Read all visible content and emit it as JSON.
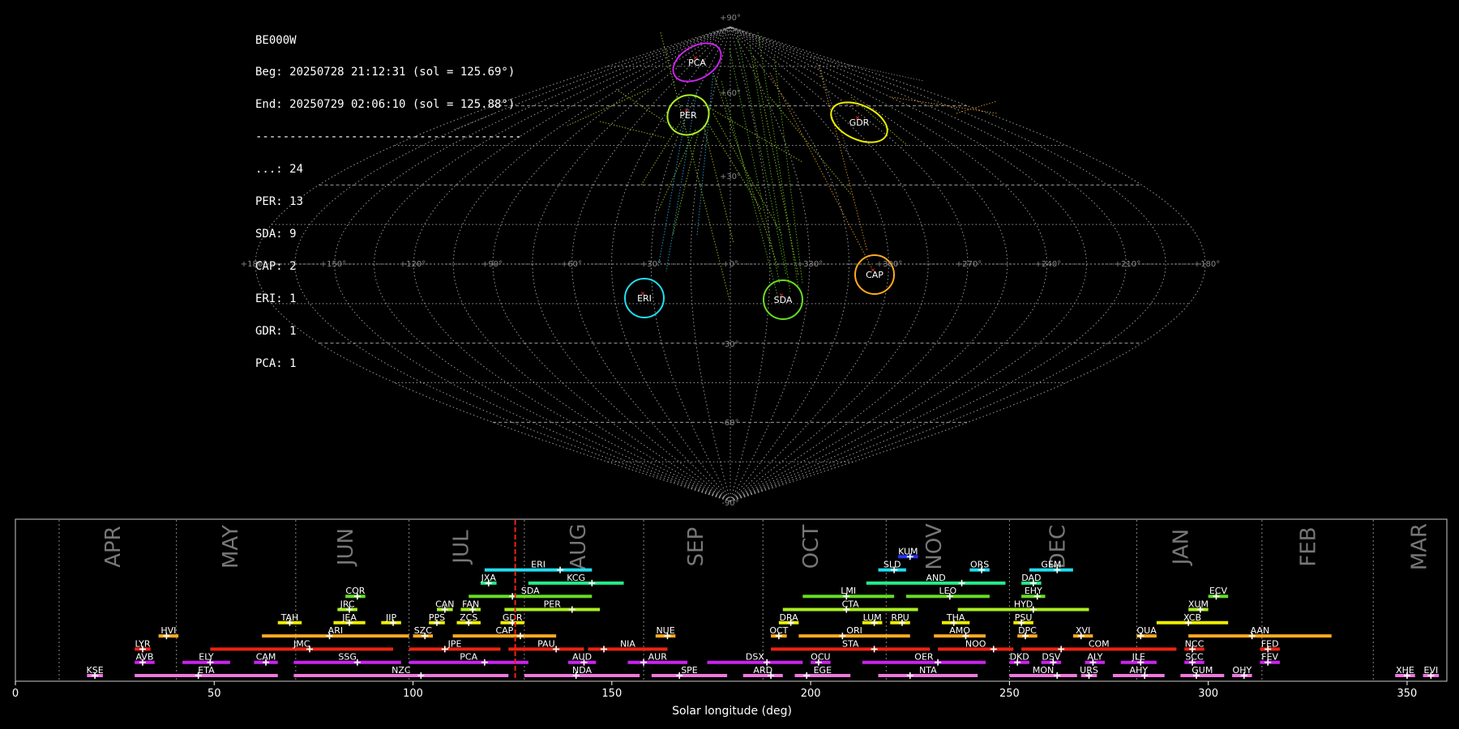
{
  "info": {
    "station": "BE000W",
    "begin": "Beg: 20250728 21:12:31 (sol = 125.69°)",
    "end": "End: 20250729 02:06:10 (sol = 125.88°)",
    "separator": "---------------------------------------",
    "counts": [
      "...: 24",
      "PER: 13",
      "SDA: 9",
      "CAP: 2",
      "ERI: 1",
      "GDR: 1",
      "PCA: 1"
    ]
  },
  "sky_map": {
    "lon_ticks": [
      "+180°",
      "+150°",
      "+120°",
      "+90°",
      "+60°",
      "+30°",
      "+0°",
      "+330°",
      "+300°",
      "+270°",
      "+240°",
      "+210°",
      "+180°"
    ],
    "lat_ticks": [
      "+90°",
      "+60°",
      "+30°",
      "-30°",
      "-60°",
      "-90°"
    ],
    "radiants": [
      {
        "code": "PCA",
        "color": "#cc22ee"
      },
      {
        "code": "PER",
        "color": "#aaee22"
      },
      {
        "code": "GDR",
        "color": "#eeee00"
      },
      {
        "code": "CAP",
        "color": "#ffaa22"
      },
      {
        "code": "ERI",
        "color": "#22ddee"
      },
      {
        "code": "SDA",
        "color": "#66dd22"
      }
    ]
  },
  "chart_data": {
    "type": "timeline",
    "xlabel": "Solar longitude (deg)",
    "xlim": [
      0,
      360
    ],
    "xticks": [
      0,
      50,
      100,
      150,
      200,
      250,
      300,
      350
    ],
    "current_sol": 125.7,
    "months": [
      {
        "name": "APR",
        "x": 24.5
      },
      {
        "name": "MAY",
        "x": 54
      },
      {
        "name": "JUN",
        "x": 83
      },
      {
        "name": "JUL",
        "x": 112
      },
      {
        "name": "AUG",
        "x": 141.5
      },
      {
        "name": "SEP",
        "x": 171
      },
      {
        "name": "OCT",
        "x": 200
      },
      {
        "name": "NOV",
        "x": 231
      },
      {
        "name": "DEC",
        "x": 262
      },
      {
        "name": "JAN",
        "x": 293
      },
      {
        "name": "FEB",
        "x": 325
      },
      {
        "name": "MAR",
        "x": 353
      }
    ],
    "month_dividers": [
      11,
      40.5,
      70.5,
      99,
      128,
      158,
      188,
      219,
      250,
      282,
      313.5,
      341.5
    ],
    "showers": [
      {
        "code": "KUM",
        "start": 222,
        "end": 227,
        "peak": 225,
        "row": 10,
        "color": "#2233ff"
      },
      {
        "code": "ERI",
        "start": 118,
        "end": 145,
        "peak": 137,
        "row": 9,
        "color": "#22ddee"
      },
      {
        "code": "SLD",
        "start": 217,
        "end": 224,
        "peak": 221,
        "row": 9,
        "color": "#22ddee"
      },
      {
        "code": "ORS",
        "start": 240,
        "end": 245,
        "peak": 243,
        "row": 9,
        "color": "#22ddee"
      },
      {
        "code": "GEM",
        "start": 255,
        "end": 266,
        "peak": 262,
        "row": 9,
        "color": "#22ddee"
      },
      {
        "code": "JXA",
        "start": 117,
        "end": 121,
        "peak": 119,
        "row": 8,
        "color": "#22ee88"
      },
      {
        "code": "KCG",
        "start": 129,
        "end": 153,
        "peak": 145,
        "row": 8,
        "color": "#22ee88"
      },
      {
        "code": "AND",
        "start": 214,
        "end": 249,
        "peak": 238,
        "row": 8,
        "color": "#22ee88"
      },
      {
        "code": "DAD",
        "start": 253,
        "end": 258,
        "peak": 256,
        "row": 8,
        "color": "#22ee88"
      },
      {
        "code": "COR",
        "start": 83,
        "end": 88,
        "peak": 86,
        "row": 7,
        "color": "#66dd22"
      },
      {
        "code": "SDA",
        "start": 114,
        "end": 145,
        "peak": 125,
        "row": 7,
        "color": "#66dd22"
      },
      {
        "code": "LMI",
        "start": 198,
        "end": 221,
        "peak": 209,
        "row": 7,
        "color": "#66dd22"
      },
      {
        "code": "LEO",
        "start": 224,
        "end": 245,
        "peak": 235,
        "row": 7,
        "color": "#66dd22"
      },
      {
        "code": "EHY",
        "start": 253,
        "end": 259,
        "peak": 257,
        "row": 7,
        "color": "#66dd22"
      },
      {
        "code": "ECV",
        "start": 300,
        "end": 305,
        "peak": 302,
        "row": 7,
        "color": "#66dd22"
      },
      {
        "code": "JRC",
        "start": 81,
        "end": 86,
        "peak": 84,
        "row": 6,
        "color": "#aaee22"
      },
      {
        "code": "CAN",
        "start": 106,
        "end": 110,
        "peak": 108,
        "row": 6,
        "color": "#aaee22"
      },
      {
        "code": "FAN",
        "start": 112,
        "end": 117,
        "peak": 115,
        "row": 6,
        "color": "#aaee22"
      },
      {
        "code": "PER",
        "start": 123,
        "end": 147,
        "peak": 140,
        "row": 6,
        "color": "#aaee22"
      },
      {
        "code": "CTA",
        "start": 193,
        "end": 227,
        "peak": 209,
        "row": 6,
        "color": "#aaee22"
      },
      {
        "code": "HYD",
        "start": 237,
        "end": 270,
        "peak": 256,
        "row": 6,
        "color": "#aaee22"
      },
      {
        "code": "XUM",
        "start": 295,
        "end": 300,
        "peak": 298,
        "row": 6,
        "color": "#aaee22"
      },
      {
        "code": "TAH",
        "start": 66,
        "end": 72,
        "peak": 69,
        "row": 5,
        "color": "#eeee00"
      },
      {
        "code": "JEA",
        "start": 80,
        "end": 88,
        "peak": 84,
        "row": 5,
        "color": "#eeee00"
      },
      {
        "code": "JIP",
        "start": 92,
        "end": 97,
        "peak": 95,
        "row": 5,
        "color": "#eeee00"
      },
      {
        "code": "PPS",
        "start": 104,
        "end": 108,
        "peak": 106,
        "row": 5,
        "color": "#eeee00"
      },
      {
        "code": "ZCS",
        "start": 111,
        "end": 117,
        "peak": 114,
        "row": 5,
        "color": "#eeee00"
      },
      {
        "code": "GDR",
        "start": 122,
        "end": 128,
        "peak": 125,
        "row": 5,
        "color": "#eeee00"
      },
      {
        "code": "DRA",
        "start": 192,
        "end": 197,
        "peak": 195,
        "row": 5,
        "color": "#eeee00"
      },
      {
        "code": "LUM",
        "start": 213,
        "end": 218,
        "peak": 216,
        "row": 5,
        "color": "#eeee00"
      },
      {
        "code": "RPU",
        "start": 220,
        "end": 225,
        "peak": 223,
        "row": 5,
        "color": "#eeee00"
      },
      {
        "code": "THA",
        "start": 233,
        "end": 240,
        "peak": 236,
        "row": 5,
        "color": "#eeee00"
      },
      {
        "code": "PSU",
        "start": 251,
        "end": 256,
        "peak": 253,
        "row": 5,
        "color": "#eeee00"
      },
      {
        "code": "XCB",
        "start": 287,
        "end": 305,
        "peak": 295,
        "row": 5,
        "color": "#eeee00"
      },
      {
        "code": "HVI",
        "start": 36,
        "end": 41,
        "peak": 38,
        "row": 4,
        "color": "#ffaa22"
      },
      {
        "code": "ARI",
        "start": 62,
        "end": 99,
        "peak": 79,
        "row": 4,
        "color": "#ffaa22"
      },
      {
        "code": "SZC",
        "start": 100,
        "end": 105,
        "peak": 103,
        "row": 4,
        "color": "#ffaa22"
      },
      {
        "code": "CAP",
        "start": 110,
        "end": 136,
        "peak": 127,
        "row": 4,
        "color": "#ffaa22"
      },
      {
        "code": "NUE",
        "start": 161,
        "end": 166,
        "peak": 164,
        "row": 4,
        "color": "#ffaa22"
      },
      {
        "code": "OCT",
        "start": 190,
        "end": 194,
        "peak": 192,
        "row": 4,
        "color": "#ffaa22"
      },
      {
        "code": "ORI",
        "start": 197,
        "end": 225,
        "peak": 208,
        "row": 4,
        "color": "#ffaa22"
      },
      {
        "code": "AMO",
        "start": 231,
        "end": 244,
        "peak": 239,
        "row": 4,
        "color": "#ffaa22"
      },
      {
        "code": "DPC",
        "start": 252,
        "end": 257,
        "peak": 254,
        "row": 4,
        "color": "#ffaa22"
      },
      {
        "code": "XVI",
        "start": 266,
        "end": 271,
        "peak": 268,
        "row": 4,
        "color": "#ffaa22"
      },
      {
        "code": "QUA",
        "start": 282,
        "end": 287,
        "peak": 283,
        "row": 4,
        "color": "#ffaa22"
      },
      {
        "code": "AAN",
        "start": 295,
        "end": 331,
        "peak": 311,
        "row": 4,
        "color": "#ffaa22"
      },
      {
        "code": "LYR",
        "start": 30,
        "end": 34,
        "peak": 32,
        "row": 3,
        "color": "#ee2211"
      },
      {
        "code": "JMC",
        "start": 49,
        "end": 95,
        "peak": 74,
        "row": 3,
        "color": "#ee2211"
      },
      {
        "code": "JPE",
        "start": 99,
        "end": 122,
        "peak": 108,
        "row": 3,
        "color": "#ee2211"
      },
      {
        "code": "PAU",
        "start": 124,
        "end": 143,
        "peak": 136,
        "row": 3,
        "color": "#ee2211"
      },
      {
        "code": "NIA",
        "start": 144,
        "end": 164,
        "peak": 148,
        "row": 3,
        "color": "#ee2211"
      },
      {
        "code": "STA",
        "start": 190,
        "end": 230,
        "peak": 216,
        "row": 3,
        "color": "#ee2211"
      },
      {
        "code": "NOO",
        "start": 232,
        "end": 251,
        "peak": 246,
        "row": 3,
        "color": "#ee2211"
      },
      {
        "code": "COM",
        "start": 253,
        "end": 292,
        "peak": 263,
        "row": 3,
        "color": "#ee2211"
      },
      {
        "code": "NCC",
        "start": 294,
        "end": 299,
        "peak": 296,
        "row": 3,
        "color": "#ee2211"
      },
      {
        "code": "FED",
        "start": 313,
        "end": 318,
        "peak": 315,
        "row": 3,
        "color": "#ee2211"
      },
      {
        "code": "AVB",
        "start": 30,
        "end": 35,
        "peak": 32,
        "row": 2,
        "color": "#cc22ee"
      },
      {
        "code": "ELY",
        "start": 42,
        "end": 54,
        "peak": 49,
        "row": 2,
        "color": "#cc22ee"
      },
      {
        "code": "CAM",
        "start": 60,
        "end": 66,
        "peak": 63,
        "row": 2,
        "color": "#cc22ee"
      },
      {
        "code": "SSG",
        "start": 70,
        "end": 97,
        "peak": 86,
        "row": 2,
        "color": "#cc22ee"
      },
      {
        "code": "PCA",
        "start": 99,
        "end": 129,
        "peak": 118,
        "row": 2,
        "color": "#cc22ee"
      },
      {
        "code": "AUD",
        "start": 139,
        "end": 146,
        "peak": 143,
        "row": 2,
        "color": "#cc22ee"
      },
      {
        "code": "AUR",
        "start": 154,
        "end": 169,
        "peak": 158,
        "row": 2,
        "color": "#cc22ee"
      },
      {
        "code": "DSX",
        "start": 174,
        "end": 198,
        "peak": 189,
        "row": 2,
        "color": "#cc22ee"
      },
      {
        "code": "OCU",
        "start": 200,
        "end": 205,
        "peak": 202,
        "row": 2,
        "color": "#cc22ee"
      },
      {
        "code": "OER",
        "start": 213,
        "end": 244,
        "peak": 232,
        "row": 2,
        "color": "#cc22ee"
      },
      {
        "code": "DKD",
        "start": 250,
        "end": 255,
        "peak": 252,
        "row": 2,
        "color": "#cc22ee"
      },
      {
        "code": "DSV",
        "start": 258,
        "end": 263,
        "peak": 261,
        "row": 2,
        "color": "#cc22ee"
      },
      {
        "code": "ALY",
        "start": 269,
        "end": 274,
        "peak": 271,
        "row": 2,
        "color": "#cc22ee"
      },
      {
        "code": "JLE",
        "start": 278,
        "end": 287,
        "peak": 283,
        "row": 2,
        "color": "#cc22ee"
      },
      {
        "code": "SCC",
        "start": 294,
        "end": 299,
        "peak": 296,
        "row": 2,
        "color": "#cc22ee"
      },
      {
        "code": "FEV",
        "start": 313,
        "end": 318,
        "peak": 315,
        "row": 2,
        "color": "#cc22ee"
      },
      {
        "code": "KSE",
        "start": 18,
        "end": 22,
        "peak": 20,
        "row": 1,
        "color": "#ee77dd"
      },
      {
        "code": "ETA",
        "start": 30,
        "end": 66,
        "peak": 46,
        "row": 1,
        "color": "#ee77dd"
      },
      {
        "code": "NZC",
        "start": 70,
        "end": 124,
        "peak": 102,
        "row": 1,
        "color": "#ee77dd"
      },
      {
        "code": "NDA",
        "start": 128,
        "end": 157,
        "peak": 141,
        "row": 1,
        "color": "#ee77dd"
      },
      {
        "code": "SPE",
        "start": 160,
        "end": 179,
        "peak": 167,
        "row": 1,
        "color": "#ee77dd"
      },
      {
        "code": "ARD",
        "start": 183,
        "end": 193,
        "peak": 190,
        "row": 1,
        "color": "#ee77dd"
      },
      {
        "code": "EGE",
        "start": 196,
        "end": 210,
        "peak": 199,
        "row": 1,
        "color": "#ee77dd"
      },
      {
        "code": "NTA",
        "start": 217,
        "end": 242,
        "peak": 225,
        "row": 1,
        "color": "#ee77dd"
      },
      {
        "code": "MON",
        "start": 250,
        "end": 267,
        "peak": 262,
        "row": 1,
        "color": "#ee77dd"
      },
      {
        "code": "URS",
        "start": 268,
        "end": 272,
        "peak": 270,
        "row": 1,
        "color": "#ee77dd"
      },
      {
        "code": "AHY",
        "start": 276,
        "end": 289,
        "peak": 284,
        "row": 1,
        "color": "#ee77dd"
      },
      {
        "code": "GUM",
        "start": 293,
        "end": 304,
        "peak": 297,
        "row": 1,
        "color": "#ee77dd"
      },
      {
        "code": "OHY",
        "start": 306,
        "end": 311,
        "peak": 309,
        "row": 1,
        "color": "#ee77dd"
      },
      {
        "code": "XHE",
        "start": 347,
        "end": 352,
        "peak": 350,
        "row": 1,
        "color": "#ee77dd"
      },
      {
        "code": "EVI",
        "start": 354,
        "end": 358,
        "peak": 356,
        "row": 1,
        "color": "#ee77dd"
      }
    ]
  }
}
